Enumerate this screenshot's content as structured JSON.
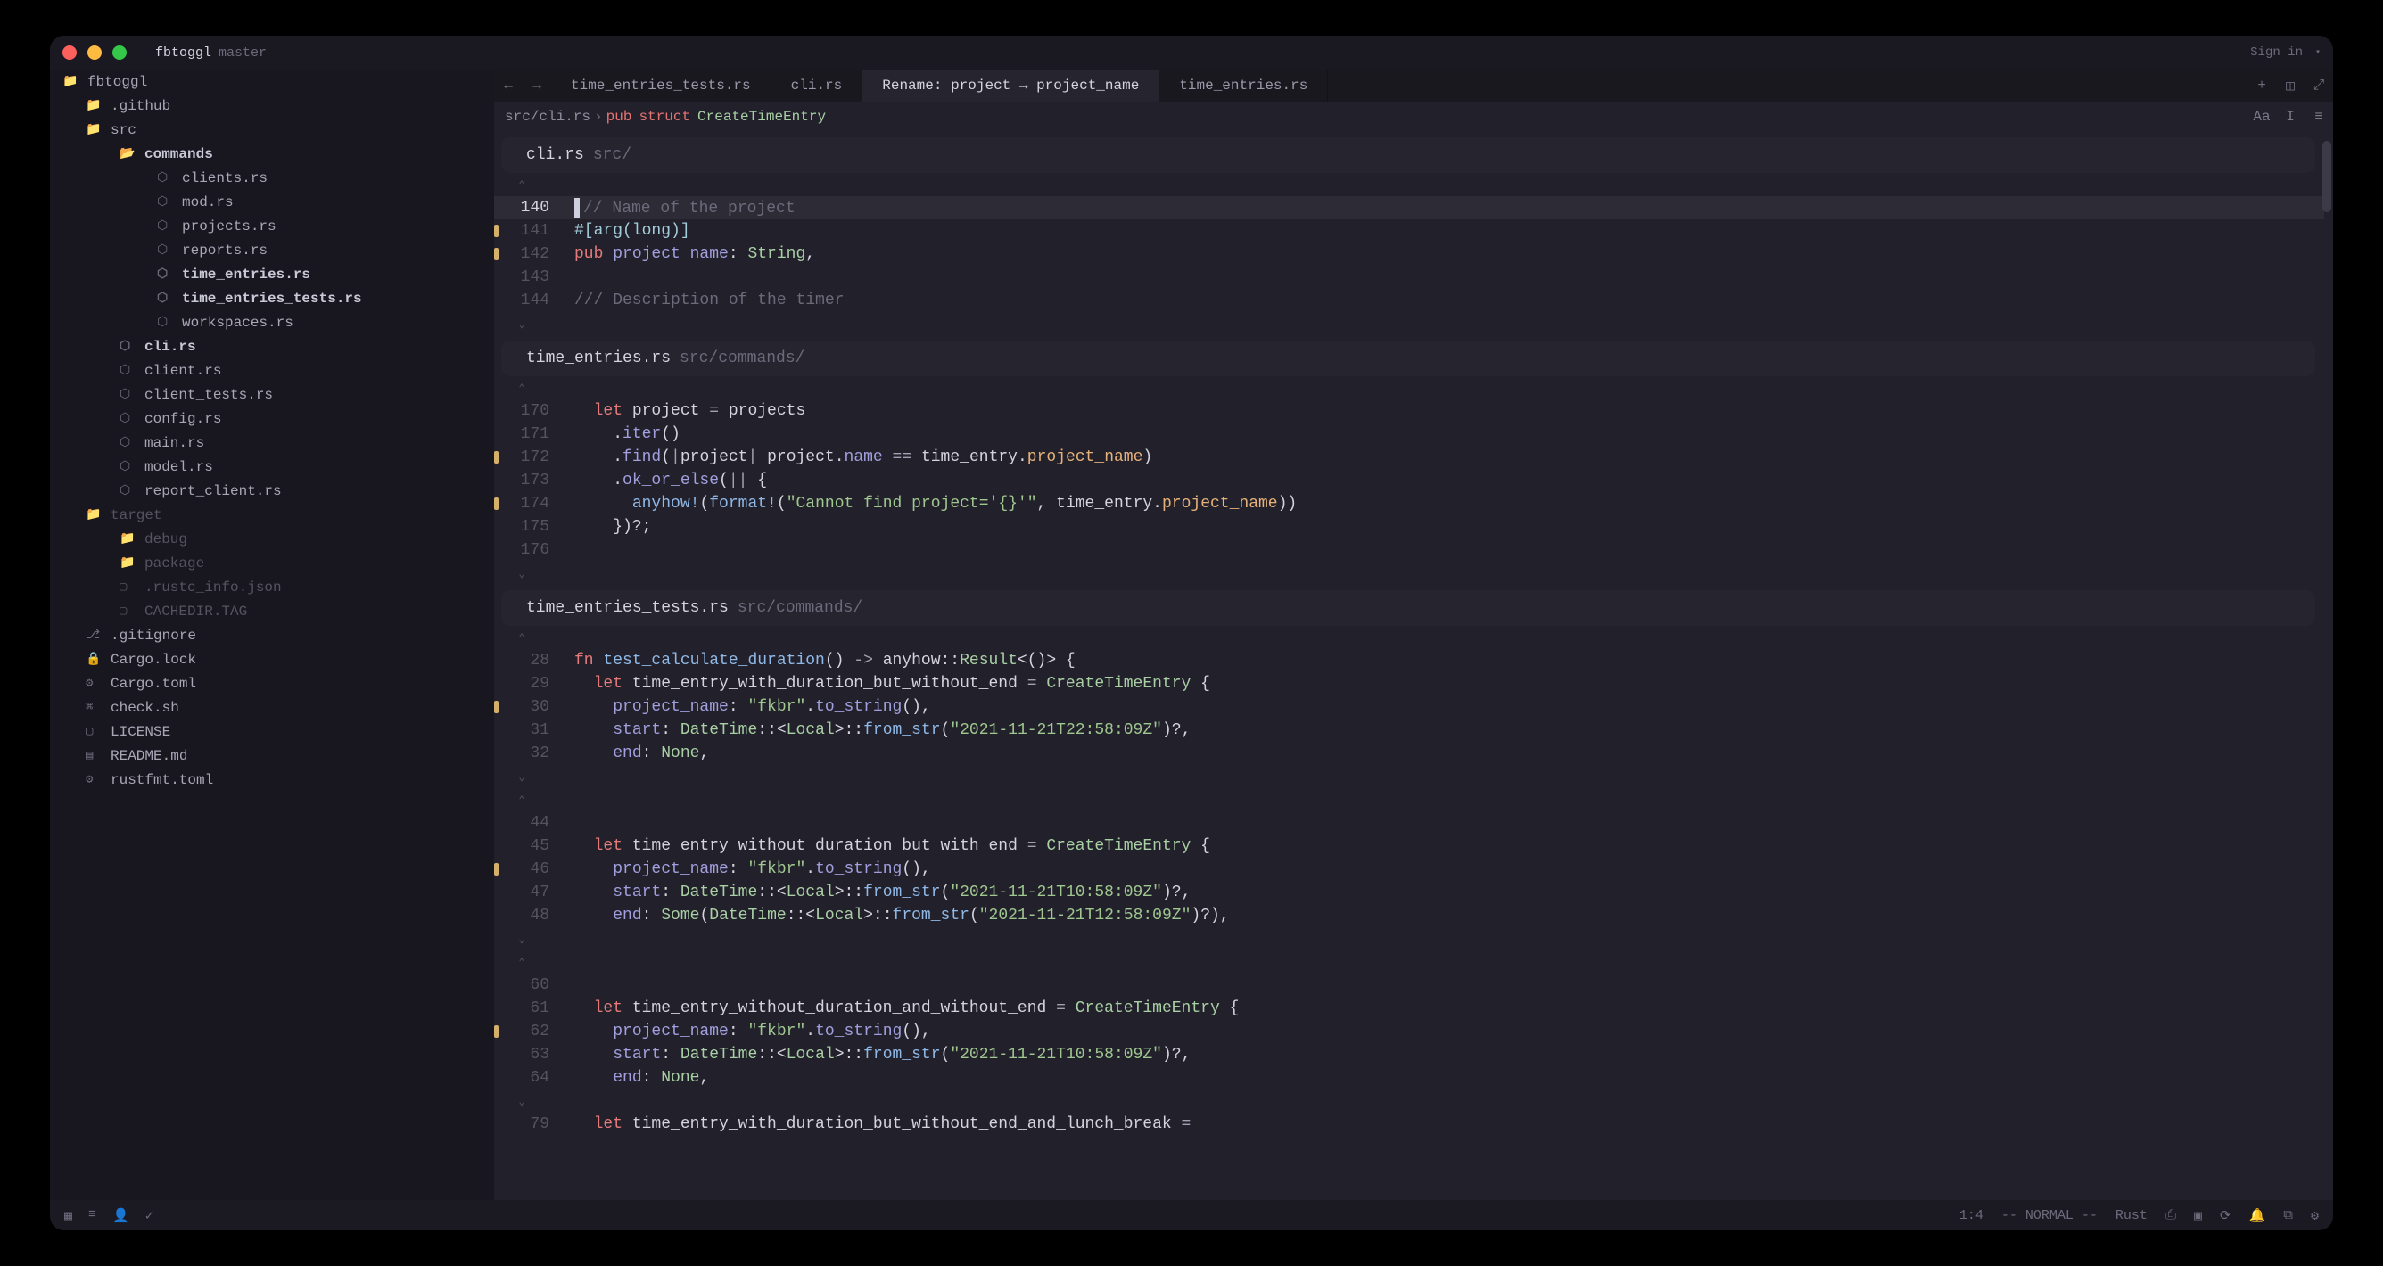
{
  "titlebar": {
    "project": "fbtoggl",
    "branch": "master",
    "signin": "Sign in"
  },
  "sidebar": [
    {
      "label": "fbtoggl",
      "level": 0,
      "cls": "root",
      "ico": "folder"
    },
    {
      "label": ".github",
      "level": 1,
      "cls": "",
      "ico": "folder-c"
    },
    {
      "label": "src",
      "level": 1,
      "cls": "",
      "ico": "folder-c"
    },
    {
      "label": "commands",
      "level": 2,
      "cls": "bold",
      "ico": "folder-o"
    },
    {
      "label": "clients.rs",
      "level": 3,
      "cls": "",
      "ico": "rust"
    },
    {
      "label": "mod.rs",
      "level": 3,
      "cls": "",
      "ico": "rust"
    },
    {
      "label": "projects.rs",
      "level": 3,
      "cls": "",
      "ico": "rust"
    },
    {
      "label": "reports.rs",
      "level": 3,
      "cls": "",
      "ico": "rust"
    },
    {
      "label": "time_entries.rs",
      "level": 3,
      "cls": "bold",
      "ico": "rust"
    },
    {
      "label": "time_entries_tests.rs",
      "level": 3,
      "cls": "bold",
      "ico": "rust"
    },
    {
      "label": "workspaces.rs",
      "level": 3,
      "cls": "",
      "ico": "rust"
    },
    {
      "label": "cli.rs",
      "level": 2,
      "cls": "bold",
      "ico": "rust"
    },
    {
      "label": "client.rs",
      "level": 2,
      "cls": "",
      "ico": "rust"
    },
    {
      "label": "client_tests.rs",
      "level": 2,
      "cls": "",
      "ico": "rust"
    },
    {
      "label": "config.rs",
      "level": 2,
      "cls": "",
      "ico": "rust"
    },
    {
      "label": "main.rs",
      "level": 2,
      "cls": "",
      "ico": "rust"
    },
    {
      "label": "model.rs",
      "level": 2,
      "cls": "",
      "ico": "rust"
    },
    {
      "label": "report_client.rs",
      "level": 2,
      "cls": "",
      "ico": "rust"
    },
    {
      "label": "target",
      "level": 1,
      "cls": "dim",
      "ico": "folder-c"
    },
    {
      "label": "debug",
      "level": 2,
      "cls": "dim",
      "ico": "folder-c"
    },
    {
      "label": "package",
      "level": 2,
      "cls": "dim",
      "ico": "folder-c"
    },
    {
      "label": ".rustc_info.json",
      "level": 2,
      "cls": "dim",
      "ico": "file"
    },
    {
      "label": "CACHEDIR.TAG",
      "level": 2,
      "cls": "dim",
      "ico": "file"
    },
    {
      "label": ".gitignore",
      "level": 1,
      "cls": "",
      "ico": "git"
    },
    {
      "label": "Cargo.lock",
      "level": 1,
      "cls": "",
      "ico": "lock"
    },
    {
      "label": "Cargo.toml",
      "level": 1,
      "cls": "",
      "ico": "toml"
    },
    {
      "label": "check.sh",
      "level": 1,
      "cls": "",
      "ico": "sh"
    },
    {
      "label": "LICENSE",
      "level": 1,
      "cls": "",
      "ico": "file"
    },
    {
      "label": "README.md",
      "level": 1,
      "cls": "",
      "ico": "md"
    },
    {
      "label": "rustfmt.toml",
      "level": 1,
      "cls": "",
      "ico": "toml"
    }
  ],
  "tabs": [
    {
      "label": "time_entries_tests.rs",
      "active": false
    },
    {
      "label": "cli.rs",
      "active": false
    },
    {
      "label": "Rename: project → project_name",
      "active": true
    },
    {
      "label": "time_entries.rs",
      "active": false
    }
  ],
  "crumb": {
    "path": "src/cli.rs",
    "pub": "pub",
    "struct": "struct",
    "name": "CreateTimeEntry"
  },
  "blocks": [
    {
      "file": "cli.rs",
      "path": "src/",
      "lines": [
        {
          "n": 140,
          "bolt": true,
          "active": true,
          "html": "<span class='cursor'></span><span class='c-cmt'>// Name of the project</span>"
        },
        {
          "n": 141,
          "changed": true,
          "html": "<span class='c-attr'>#[arg(long)]</span>"
        },
        {
          "n": 142,
          "changed": true,
          "html": "<span class='c-kw'>pub</span> <span class='c-field'>project_name</span>: <span class='c-type'>String</span>,"
        },
        {
          "n": 143,
          "html": ""
        },
        {
          "n": 144,
          "html": "<span class='c-cmt'>/// Description of the timer</span>"
        }
      ]
    },
    {
      "file": "time_entries.rs",
      "path": "src/commands/",
      "lines": [
        {
          "n": 170,
          "html": "  <span class='c-kw'>let</span> project <span class='c-op'>=</span> projects"
        },
        {
          "n": 171,
          "html": "    .<span class='c-call'>iter</span>()"
        },
        {
          "n": 172,
          "changed": true,
          "html": "    .<span class='c-call'>find</span>(<span class='c-op'>|</span>project<span class='c-op'>|</span> project.<span class='c-field'>name</span> <span class='c-op'>==</span> time_entry.<span class='c-match'>project_name</span>)"
        },
        {
          "n": 173,
          "html": "    .<span class='c-call'>ok_or_else</span>(<span class='c-op'>||</span> {"
        },
        {
          "n": 174,
          "changed": true,
          "html": "      <span class='c-fn'>anyhow!</span>(<span class='c-fn'>format!</span>(<span class='c-str'>\"Cannot find project='{}'\"</span>, time_entry.<span class='c-match'>project_name</span>))"
        },
        {
          "n": 175,
          "html": "    })?;"
        },
        {
          "n": 176,
          "html": ""
        }
      ]
    },
    {
      "file": "time_entries_tests.rs",
      "path": "src/commands/",
      "lines": [
        {
          "n": 28,
          "html": "<span class='c-kw'>fn</span> <span class='c-fn'>test_calculate_duration</span>() <span class='c-op'>-&gt;</span> anyhow::<span class='c-type'>Result</span>&lt;()&gt; {"
        },
        {
          "n": 29,
          "html": "  <span class='c-kw'>let</span> time_entry_with_duration_but_without_end <span class='c-op'>=</span> <span class='c-type'>CreateTimeEntry</span> {"
        },
        {
          "n": 30,
          "changed": true,
          "html": "    <span class='c-field'>project_name</span>: <span class='c-str'>\"fkbr\"</span>.<span class='c-call'>to_string</span>(),"
        },
        {
          "n": 31,
          "html": "    <span class='c-field'>start</span>: <span class='c-type'>DateTime</span>::&lt;<span class='c-type'>Local</span>&gt;::<span class='c-fn'>from_str</span>(<span class='c-str'>\"2021-11-21T22:58:09Z\"</span>)?,"
        },
        {
          "n": 32,
          "html": "    <span class='c-field'>end</span>: <span class='c-type'>None</span>,"
        }
      ],
      "gap_after": true,
      "lines2": [
        {
          "n": 44,
          "html": ""
        },
        {
          "n": 45,
          "html": "  <span class='c-kw'>let</span> time_entry_without_duration_but_with_end <span class='c-op'>=</span> <span class='c-type'>CreateTimeEntry</span> {"
        },
        {
          "n": 46,
          "changed": true,
          "html": "    <span class='c-field'>project_name</span>: <span class='c-str'>\"fkbr\"</span>.<span class='c-call'>to_string</span>(),"
        },
        {
          "n": 47,
          "html": "    <span class='c-field'>start</span>: <span class='c-type'>DateTime</span>::&lt;<span class='c-type'>Local</span>&gt;::<span class='c-fn'>from_str</span>(<span class='c-str'>\"2021-11-21T10:58:09Z\"</span>)?,"
        },
        {
          "n": 48,
          "html": "    <span class='c-field'>end</span>: <span class='c-type'>Some</span>(<span class='c-type'>DateTime</span>::&lt;<span class='c-type'>Local</span>&gt;::<span class='c-fn'>from_str</span>(<span class='c-str'>\"2021-11-21T12:58:09Z\"</span>)?),"
        }
      ],
      "gap_after2": true,
      "lines3": [
        {
          "n": 60,
          "html": ""
        },
        {
          "n": 61,
          "html": "  <span class='c-kw'>let</span> time_entry_without_duration_and_without_end <span class='c-op'>=</span> <span class='c-type'>CreateTimeEntry</span> {"
        },
        {
          "n": 62,
          "changed": true,
          "html": "    <span class='c-field'>project_name</span>: <span class='c-str'>\"fkbr\"</span>.<span class='c-call'>to_string</span>(),"
        },
        {
          "n": 63,
          "html": "    <span class='c-field'>start</span>: <span class='c-type'>DateTime</span>::&lt;<span class='c-type'>Local</span>&gt;::<span class='c-fn'>from_str</span>(<span class='c-str'>\"2021-11-21T10:58:09Z\"</span>)?,"
        },
        {
          "n": 64,
          "html": "    <span class='c-field'>end</span>: <span class='c-type'>None</span>,"
        }
      ],
      "gap_after3": true,
      "lines4": [
        {
          "n": 79,
          "html": "  <span class='c-kw'>let</span> time_entry_with_duration_but_without_end_and_lunch_break <span class='c-op'>=</span>"
        }
      ]
    }
  ],
  "status": {
    "pos": "1:4",
    "mode": "-- NORMAL --",
    "lang": "Rust"
  },
  "icons": {
    "folder": "▸",
    "folder-o": "▾",
    "folder-c": "▸",
    "rust": "⬡",
    "file": "▢",
    "git": "⎇",
    "lock": "🔒",
    "toml": "⚙",
    "sh": "⌘",
    "md": "▤"
  }
}
